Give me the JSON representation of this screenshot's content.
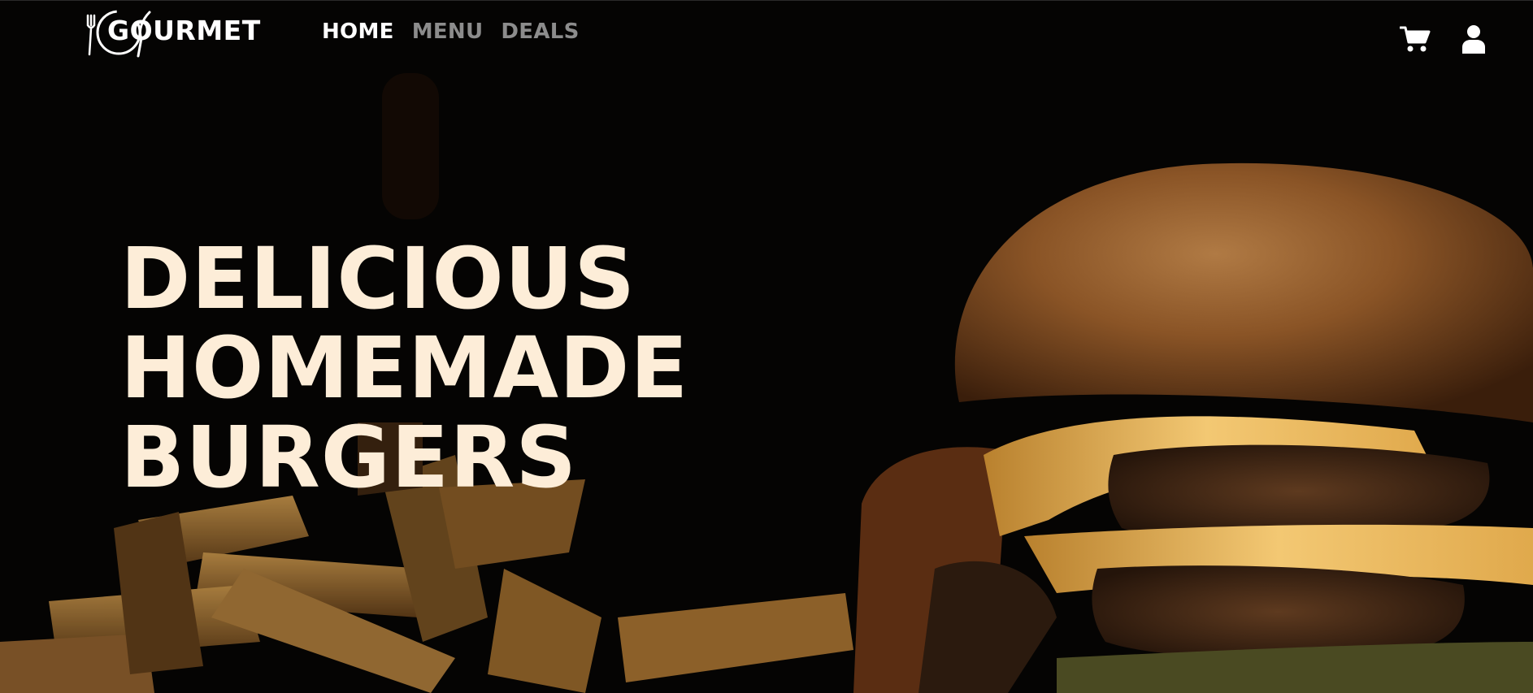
{
  "brand": {
    "name": "GOURMET"
  },
  "nav": {
    "items": [
      {
        "label": "HOME",
        "active": true
      },
      {
        "label": "MENU",
        "active": false
      },
      {
        "label": "DEALS",
        "active": false
      }
    ]
  },
  "header_actions": {
    "cart_icon": "shopping-cart-icon",
    "user_icon": "user-icon"
  },
  "hero": {
    "headline_lines": [
      "DELICIOUS",
      "HOMEMADE",
      "BURGERS"
    ],
    "image": "burger-and-fries-photo"
  },
  "colors": {
    "background": "#050403",
    "headline": "#fdedd8",
    "nav_active": "#ffffff",
    "nav_inactive": "#8c8c8c"
  }
}
